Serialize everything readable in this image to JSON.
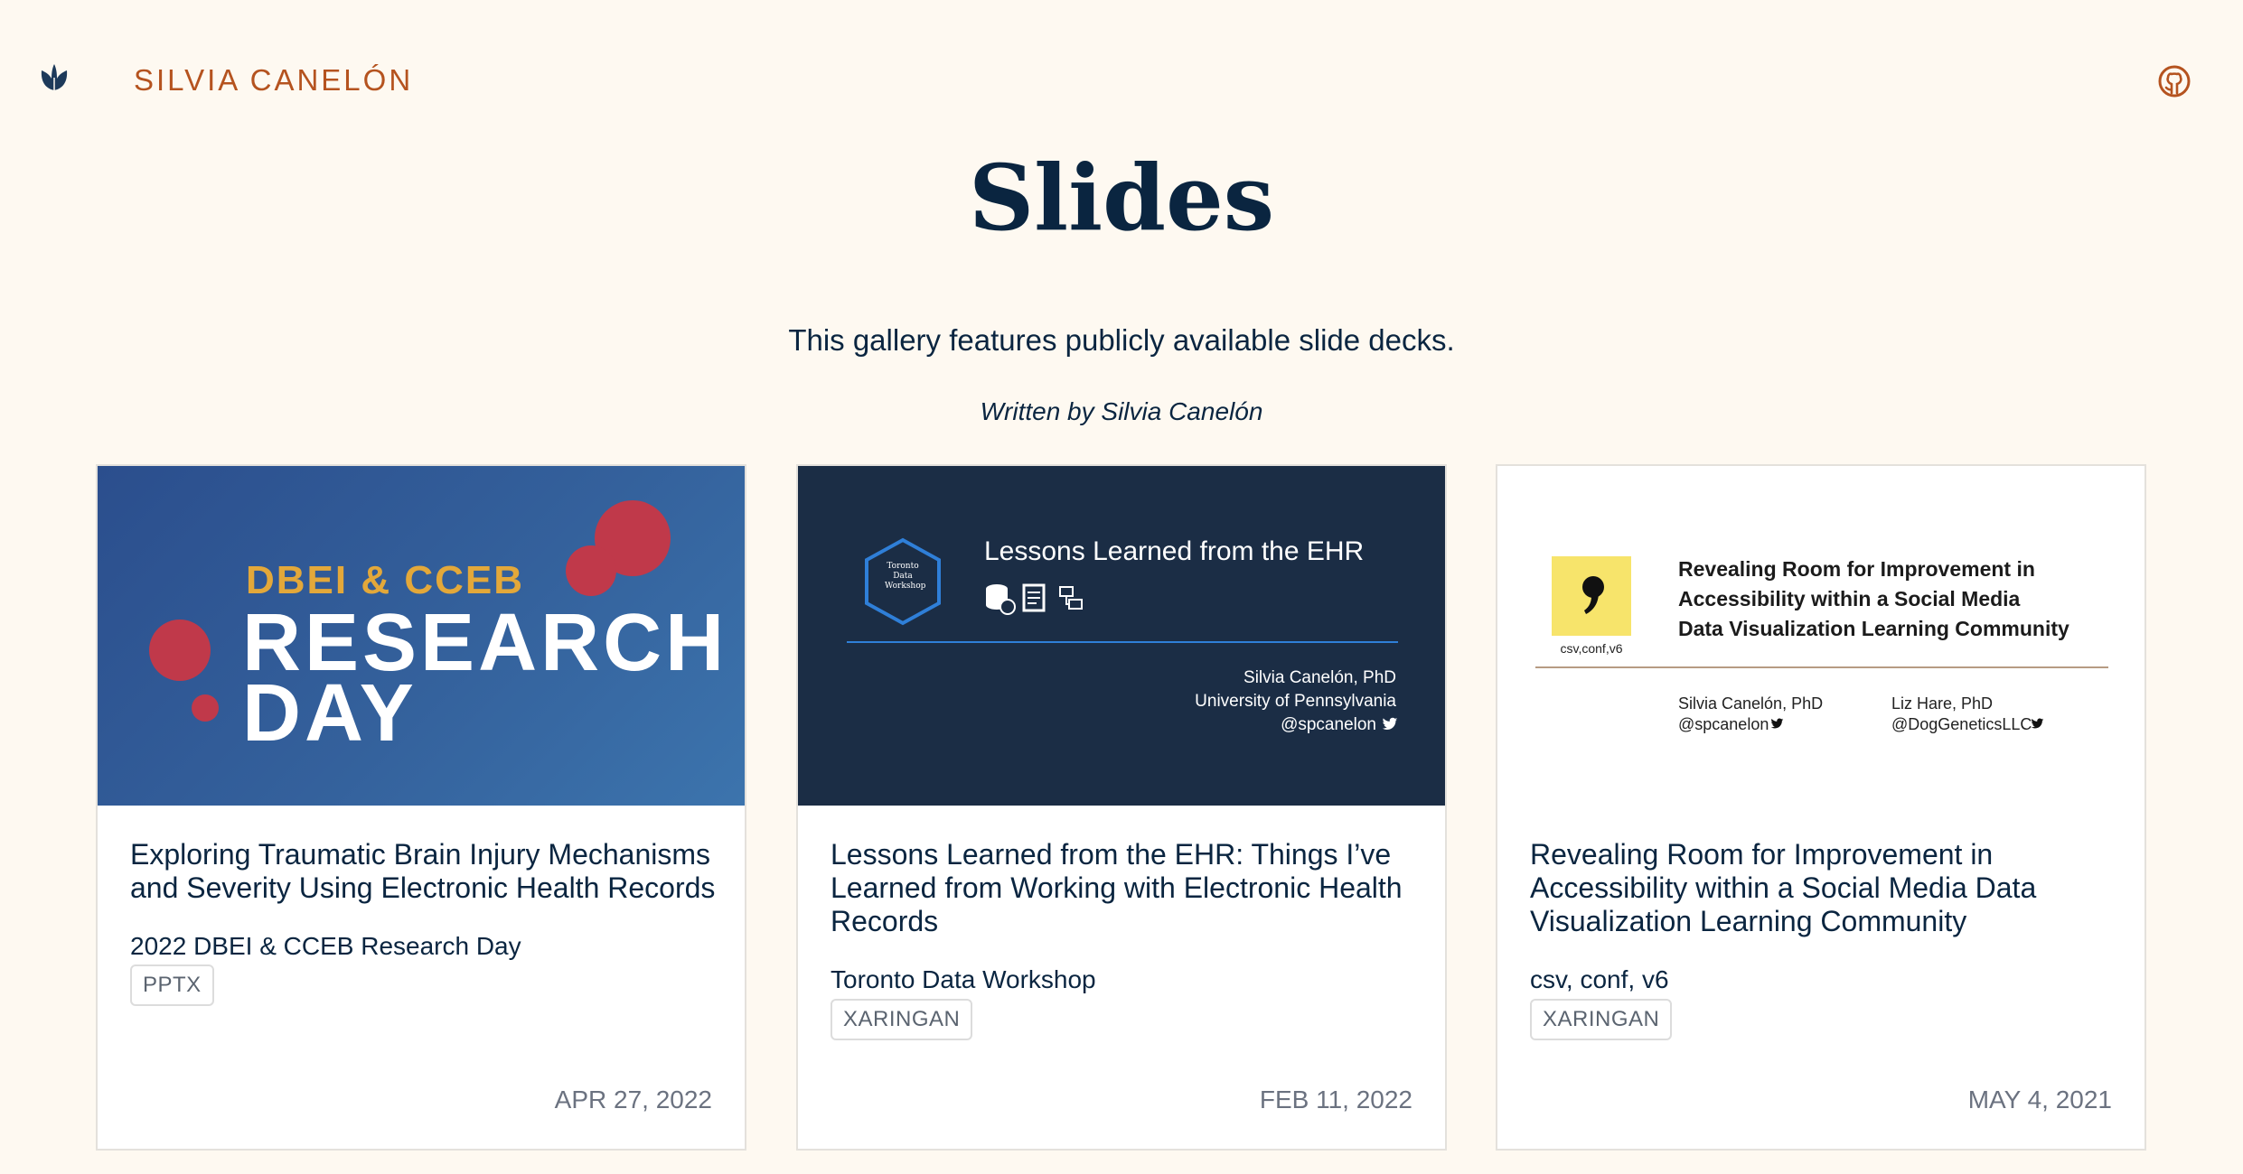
{
  "header": {
    "site_title": "SILVIA CANELÓN",
    "logo_icon": "tulip-icon",
    "github_icon": "github-icon"
  },
  "page": {
    "title": "Slides",
    "description": "This gallery features publicly available slide decks.",
    "byline": "Written by Silvia Canelón"
  },
  "colors": {
    "background": "#fef9f1",
    "accent": "#b5531f",
    "text": "#0a2540"
  },
  "cards": [
    {
      "title": "Exploring Traumatic Brain Injury Mechanisms and Severity Using Electronic Health Records",
      "event": "2022 DBEI & CCEB Research Day",
      "tag": "PPTX",
      "date": "APR 27, 2022",
      "thumb": {
        "kicker": "DBEI & CCEB",
        "line1": "RESEARCH",
        "line2": "DAY"
      }
    },
    {
      "title": "Lessons Learned from the EHR: Things I’ve Learned from Working with Electronic Health Records",
      "event": "Toronto Data Workshop",
      "tag": "XARINGAN",
      "date": "FEB 11, 2022",
      "thumb": {
        "heading": "Lessons Learned from the EHR",
        "badge_line1": "Toronto",
        "badge_line2": "Data",
        "badge_line3": "Workshop",
        "author": "Silvia Canelón, PhD",
        "affiliation": "University of Pennsylvania",
        "handle": "@spcanelon"
      }
    },
    {
      "title": "Revealing Room for Improvement in Accessibility within a Social Media Data Visualization Learning Community",
      "event": "csv, conf, v6",
      "tag": "XARINGAN",
      "date": "MAY 4, 2021",
      "thumb": {
        "logo_label": "csv,conf,v6",
        "heading_line1": "Revealing Room for Improvement in",
        "heading_line2": "Accessibility within a Social Media",
        "heading_line3": "Data Visualization Learning Community",
        "author1": "Silvia Canelón, PhD",
        "handle1": "@spcanelon",
        "author2": "Liz Hare, PhD",
        "handle2": "@DogGeneticsLLC"
      }
    }
  ]
}
